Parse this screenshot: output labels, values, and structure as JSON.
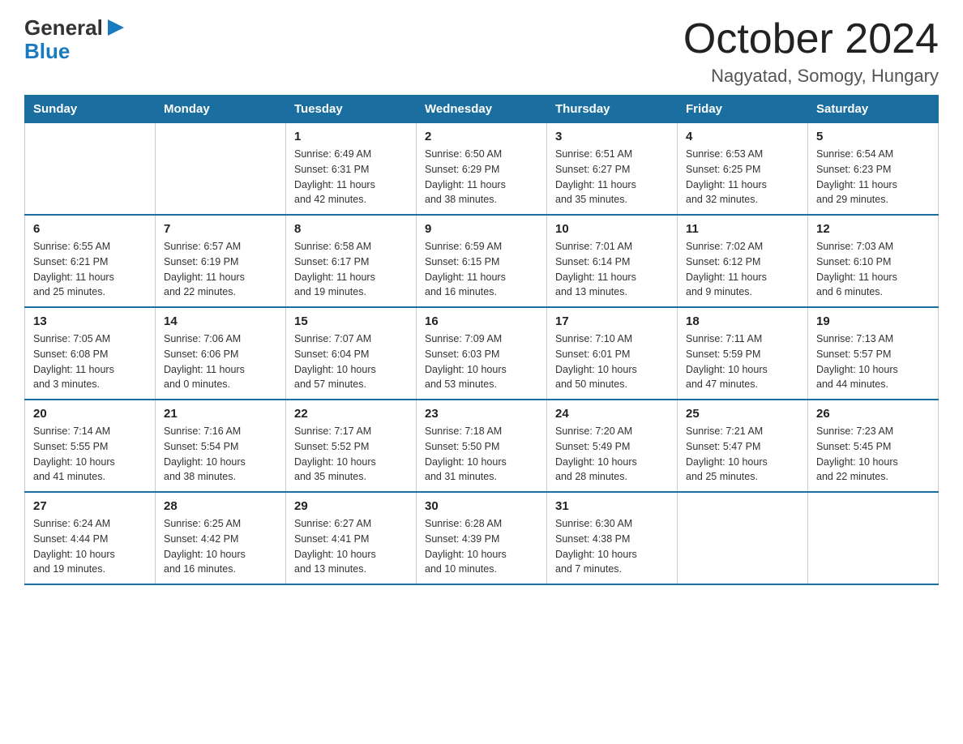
{
  "logo": {
    "general": "General",
    "blue": "Blue"
  },
  "title": "October 2024",
  "subtitle": "Nagyatad, Somogy, Hungary",
  "headers": [
    "Sunday",
    "Monday",
    "Tuesday",
    "Wednesday",
    "Thursday",
    "Friday",
    "Saturday"
  ],
  "weeks": [
    [
      {
        "day": "",
        "info": ""
      },
      {
        "day": "",
        "info": ""
      },
      {
        "day": "1",
        "info": "Sunrise: 6:49 AM\nSunset: 6:31 PM\nDaylight: 11 hours\nand 42 minutes."
      },
      {
        "day": "2",
        "info": "Sunrise: 6:50 AM\nSunset: 6:29 PM\nDaylight: 11 hours\nand 38 minutes."
      },
      {
        "day": "3",
        "info": "Sunrise: 6:51 AM\nSunset: 6:27 PM\nDaylight: 11 hours\nand 35 minutes."
      },
      {
        "day": "4",
        "info": "Sunrise: 6:53 AM\nSunset: 6:25 PM\nDaylight: 11 hours\nand 32 minutes."
      },
      {
        "day": "5",
        "info": "Sunrise: 6:54 AM\nSunset: 6:23 PM\nDaylight: 11 hours\nand 29 minutes."
      }
    ],
    [
      {
        "day": "6",
        "info": "Sunrise: 6:55 AM\nSunset: 6:21 PM\nDaylight: 11 hours\nand 25 minutes."
      },
      {
        "day": "7",
        "info": "Sunrise: 6:57 AM\nSunset: 6:19 PM\nDaylight: 11 hours\nand 22 minutes."
      },
      {
        "day": "8",
        "info": "Sunrise: 6:58 AM\nSunset: 6:17 PM\nDaylight: 11 hours\nand 19 minutes."
      },
      {
        "day": "9",
        "info": "Sunrise: 6:59 AM\nSunset: 6:15 PM\nDaylight: 11 hours\nand 16 minutes."
      },
      {
        "day": "10",
        "info": "Sunrise: 7:01 AM\nSunset: 6:14 PM\nDaylight: 11 hours\nand 13 minutes."
      },
      {
        "day": "11",
        "info": "Sunrise: 7:02 AM\nSunset: 6:12 PM\nDaylight: 11 hours\nand 9 minutes."
      },
      {
        "day": "12",
        "info": "Sunrise: 7:03 AM\nSunset: 6:10 PM\nDaylight: 11 hours\nand 6 minutes."
      }
    ],
    [
      {
        "day": "13",
        "info": "Sunrise: 7:05 AM\nSunset: 6:08 PM\nDaylight: 11 hours\nand 3 minutes."
      },
      {
        "day": "14",
        "info": "Sunrise: 7:06 AM\nSunset: 6:06 PM\nDaylight: 11 hours\nand 0 minutes."
      },
      {
        "day": "15",
        "info": "Sunrise: 7:07 AM\nSunset: 6:04 PM\nDaylight: 10 hours\nand 57 minutes."
      },
      {
        "day": "16",
        "info": "Sunrise: 7:09 AM\nSunset: 6:03 PM\nDaylight: 10 hours\nand 53 minutes."
      },
      {
        "day": "17",
        "info": "Sunrise: 7:10 AM\nSunset: 6:01 PM\nDaylight: 10 hours\nand 50 minutes."
      },
      {
        "day": "18",
        "info": "Sunrise: 7:11 AM\nSunset: 5:59 PM\nDaylight: 10 hours\nand 47 minutes."
      },
      {
        "day": "19",
        "info": "Sunrise: 7:13 AM\nSunset: 5:57 PM\nDaylight: 10 hours\nand 44 minutes."
      }
    ],
    [
      {
        "day": "20",
        "info": "Sunrise: 7:14 AM\nSunset: 5:55 PM\nDaylight: 10 hours\nand 41 minutes."
      },
      {
        "day": "21",
        "info": "Sunrise: 7:16 AM\nSunset: 5:54 PM\nDaylight: 10 hours\nand 38 minutes."
      },
      {
        "day": "22",
        "info": "Sunrise: 7:17 AM\nSunset: 5:52 PM\nDaylight: 10 hours\nand 35 minutes."
      },
      {
        "day": "23",
        "info": "Sunrise: 7:18 AM\nSunset: 5:50 PM\nDaylight: 10 hours\nand 31 minutes."
      },
      {
        "day": "24",
        "info": "Sunrise: 7:20 AM\nSunset: 5:49 PM\nDaylight: 10 hours\nand 28 minutes."
      },
      {
        "day": "25",
        "info": "Sunrise: 7:21 AM\nSunset: 5:47 PM\nDaylight: 10 hours\nand 25 minutes."
      },
      {
        "day": "26",
        "info": "Sunrise: 7:23 AM\nSunset: 5:45 PM\nDaylight: 10 hours\nand 22 minutes."
      }
    ],
    [
      {
        "day": "27",
        "info": "Sunrise: 6:24 AM\nSunset: 4:44 PM\nDaylight: 10 hours\nand 19 minutes."
      },
      {
        "day": "28",
        "info": "Sunrise: 6:25 AM\nSunset: 4:42 PM\nDaylight: 10 hours\nand 16 minutes."
      },
      {
        "day": "29",
        "info": "Sunrise: 6:27 AM\nSunset: 4:41 PM\nDaylight: 10 hours\nand 13 minutes."
      },
      {
        "day": "30",
        "info": "Sunrise: 6:28 AM\nSunset: 4:39 PM\nDaylight: 10 hours\nand 10 minutes."
      },
      {
        "day": "31",
        "info": "Sunrise: 6:30 AM\nSunset: 4:38 PM\nDaylight: 10 hours\nand 7 minutes."
      },
      {
        "day": "",
        "info": ""
      },
      {
        "day": "",
        "info": ""
      }
    ]
  ]
}
